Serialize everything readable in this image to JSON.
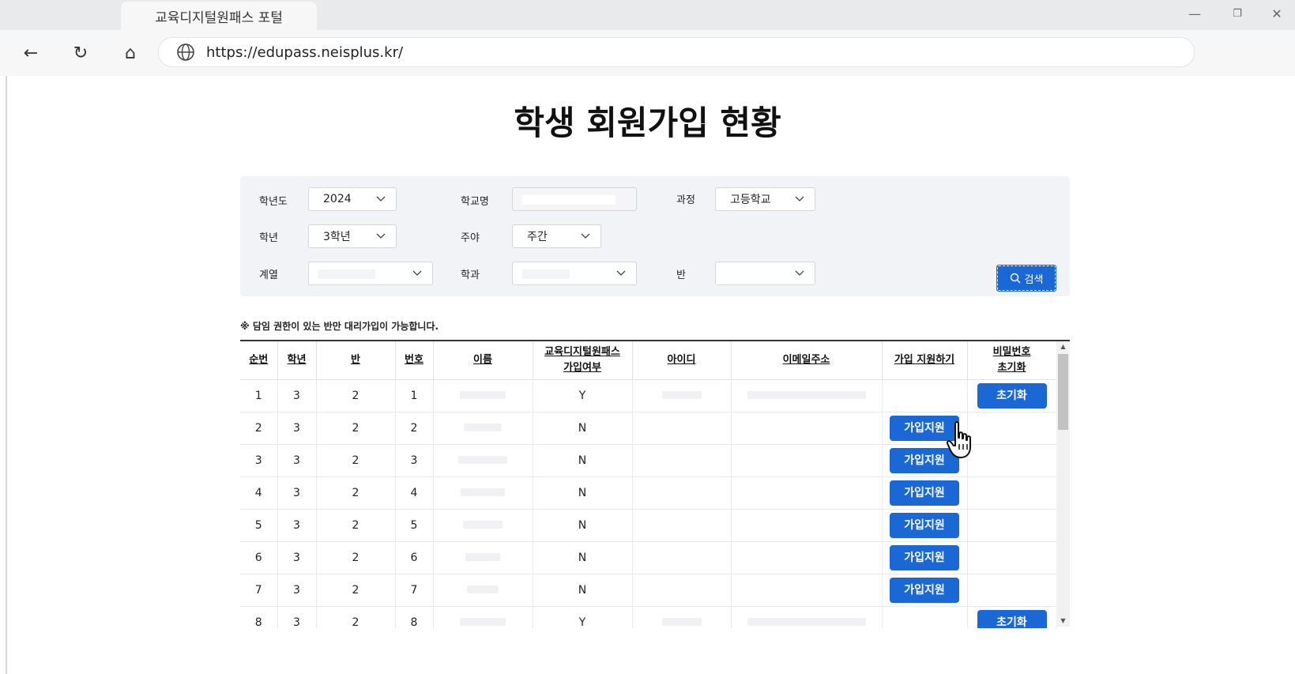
{
  "browser": {
    "tab_title": "교육디지털원패스 포털",
    "url": "https://edupass.neisplus.kr/",
    "minimize": "—",
    "restore": "❐",
    "close": "✕",
    "back": "←",
    "reload": "↻",
    "home": "⌂"
  },
  "page": {
    "title": "학생 회원가입 현황"
  },
  "filters": {
    "year_label": "학년도",
    "year_value": "2024",
    "school_label": "학교명",
    "course_label": "과정",
    "course_value": "고등학교",
    "grade_label": "학년",
    "grade_value": "3학년",
    "daynight_label": "주야",
    "daynight_value": "주간",
    "series_label": "계열",
    "dept_label": "학과",
    "class_label": "반",
    "search_label": "검색"
  },
  "notice": "※ 담임 권한이 있는 반만 대리가입이 가능합니다.",
  "table": {
    "headers": {
      "seq": "순번",
      "grade": "학년",
      "class": "반",
      "number": "번호",
      "name": "이름",
      "joined_1": "교육디지털원패스",
      "joined_2": "가입여부",
      "id": "아이디",
      "email": "이메일주소",
      "support": "가입 지원하기",
      "reset_1": "비밀번호",
      "reset_2": "초기화"
    },
    "support_button": "가입지원",
    "reset_button": "초기화",
    "rows": [
      {
        "seq": "1",
        "grade": "3",
        "class": "2",
        "number": "1",
        "joined": "Y"
      },
      {
        "seq": "2",
        "grade": "3",
        "class": "2",
        "number": "2",
        "joined": "N"
      },
      {
        "seq": "3",
        "grade": "3",
        "class": "2",
        "number": "3",
        "joined": "N"
      },
      {
        "seq": "4",
        "grade": "3",
        "class": "2",
        "number": "4",
        "joined": "N"
      },
      {
        "seq": "5",
        "grade": "3",
        "class": "2",
        "number": "5",
        "joined": "N"
      },
      {
        "seq": "6",
        "grade": "3",
        "class": "2",
        "number": "6",
        "joined": "N"
      },
      {
        "seq": "7",
        "grade": "3",
        "class": "2",
        "number": "7",
        "joined": "N"
      },
      {
        "seq": "8",
        "grade": "3",
        "class": "2",
        "number": "8",
        "joined": "Y"
      }
    ]
  },
  "colors": {
    "accent": "#1a67d6",
    "filter_bg": "#f2f3f6"
  }
}
